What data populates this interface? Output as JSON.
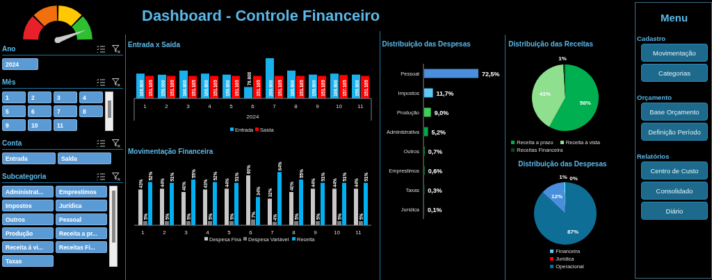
{
  "dashboard_title": "Dashboard - Controle Financeiro",
  "slicers": [
    {
      "title": "Ano",
      "kind": "compact",
      "items": [
        {
          "label": "2024",
          "selected": true
        }
      ]
    },
    {
      "title": "Mês",
      "kind": "grid",
      "items": [
        {
          "label": "1",
          "selected": true
        },
        {
          "label": "2",
          "selected": true
        },
        {
          "label": "3",
          "selected": true
        },
        {
          "label": "4",
          "selected": true
        },
        {
          "label": "5",
          "selected": true
        },
        {
          "label": "6",
          "selected": true
        },
        {
          "label": "7",
          "selected": true
        },
        {
          "label": "8",
          "selected": true
        },
        {
          "label": "9",
          "selected": true
        },
        {
          "label": "10",
          "selected": true
        },
        {
          "label": "11",
          "selected": true
        }
      ]
    },
    {
      "title": "Conta",
      "kind": "pair",
      "items": [
        {
          "label": "Entrada",
          "selected": true
        },
        {
          "label": "Saída",
          "selected": true
        }
      ]
    },
    {
      "title": "Subcategoria",
      "kind": "list",
      "items": [
        {
          "label": "Administrat...",
          "selected": true
        },
        {
          "label": "Emprestimos",
          "selected": true
        },
        {
          "label": "Impostos",
          "selected": true
        },
        {
          "label": "Jurídica",
          "selected": true
        },
        {
          "label": "Outros",
          "selected": true
        },
        {
          "label": "Pessoal",
          "selected": true
        },
        {
          "label": "Produção",
          "selected": true
        },
        {
          "label": "Receita a pr...",
          "selected": true
        },
        {
          "label": "Receita á vi...",
          "selected": true
        },
        {
          "label": "Receitas Fi...",
          "selected": true
        },
        {
          "label": "Taxas",
          "selected": true
        }
      ]
    }
  ],
  "entrada_saida": {
    "chart_data": {
      "type": "bar",
      "title": "Entrada x Saída",
      "xlabel": "2024",
      "legend": "bottom",
      "categories": [
        "1",
        "2",
        "3",
        "4",
        "5",
        "6",
        "7",
        "8",
        "9",
        "10",
        "11"
      ],
      "data_labels": true,
      "series": [
        {
          "name": "Entrada",
          "color": "#1ab0ec",
          "values": [
            166800,
            159000,
            186800,
            166800,
            159800,
            76800,
            269800,
            186800,
            159800,
            166800,
            159800
          ],
          "value_labels": [
            "166.800",
            "159.000",
            "186.800",
            "166.800",
            "159.800",
            "76.800",
            "269.800",
            "186.800",
            "159.800",
            "166.800",
            "159.800"
          ]
        },
        {
          "name": "Saída",
          "color": "#ff0000",
          "values": [
            151165,
            151165,
            151165,
            151165,
            151165,
            151165,
            151165,
            151165,
            151165,
            157165,
            151165
          ],
          "value_labels": [
            "151.165",
            "151.165",
            "151.165",
            "151.165",
            "151.165",
            "151.165",
            "151.165",
            "151.165",
            "151.165",
            "157.165",
            "151.165"
          ]
        }
      ]
    }
  },
  "movimentacao": {
    "chart_data": {
      "type": "bar",
      "title": "Movimentação Financeira",
      "legend": "bottom",
      "categories": [
        "1",
        "2",
        "3",
        "4",
        "5",
        "6",
        "7",
        "8",
        "9",
        "10",
        "11"
      ],
      "data_labels": true,
      "series": [
        {
          "name": "Despesa Fixa",
          "color": "#c8c8c8",
          "values": [
            43,
            44,
            40,
            43,
            44,
            60,
            32,
            40,
            44,
            44,
            44
          ],
          "value_labels": [
            "43%",
            "44%",
            "40%",
            "43%",
            "44%",
            "60%",
            "32%",
            "40%",
            "44%",
            "44%",
            "44%"
          ]
        },
        {
          "name": "Despesa Variável",
          "color": "#7f7f7f",
          "values": [
            5,
            5,
            5,
            5,
            5,
            7,
            4,
            5,
            5,
            5,
            5
          ],
          "value_labels": [
            "5%",
            "5%",
            "5%",
            "5%",
            "5%",
            "7%",
            "4%",
            "5%",
            "5%",
            "5%",
            "5%"
          ]
        },
        {
          "name": "Receita",
          "color": "#00b0f0",
          "values": [
            52,
            51,
            55,
            52,
            51,
            34,
            64,
            55,
            51,
            51,
            51
          ],
          "value_labels": [
            "52%",
            "51%",
            "55%",
            "52%",
            "51%",
            "34%",
            "64%",
            "55%",
            "51%",
            "51%",
            "51%"
          ]
        }
      ]
    }
  },
  "despesas_bar": {
    "chart_data": {
      "type": "bar",
      "orientation": "horizontal",
      "title": "Distribuição das Despesas",
      "categories": [
        "Pessoal",
        "Impostos",
        "Produção",
        "Administrativa",
        "Outros",
        "Emprestimos",
        "Taxas",
        "Jurídica"
      ],
      "data_labels": true,
      "series": [
        {
          "values": [
            72.5,
            11.7,
            9.0,
            5.2,
            0.7,
            0.6,
            0.3,
            0.1
          ],
          "value_labels": [
            "72,5%",
            "11,7%",
            "9,0%",
            "5,2%",
            "0,7%",
            "0,6%",
            "0,3%",
            "0,1%"
          ],
          "colors": [
            "#4a8fdb",
            "#5bc8f5",
            "#3ecf5a",
            "#00a846",
            "#00a846",
            "#00a846",
            "#00a846",
            "#00a846"
          ]
        }
      ]
    }
  },
  "receitas_pie": {
    "chart_data": {
      "type": "pie",
      "title": "Distribuição das Receitas",
      "legend": "bottom",
      "categories": [
        "Receita a prazo",
        "Receita á vista",
        "Receitas Financeira"
      ],
      "data_labels": true,
      "series": [
        {
          "values": [
            58,
            41,
            1
          ],
          "value_labels": [
            "58%",
            "41%",
            "1%"
          ],
          "colors": [
            "#00b050",
            "#8ee08e",
            "#0c4a1e"
          ]
        }
      ]
    }
  },
  "despesas_pie": {
    "chart_data": {
      "type": "pie",
      "title": "Distribuição das Despesas",
      "legend": "bottom",
      "categories": [
        "Financeira",
        "Jurídica",
        "Operacional",
        null
      ],
      "data_labels": true,
      "series": [
        {
          "values": [
            1,
            0,
            87,
            12
          ],
          "value_labels": [
            "1%",
            "0%",
            "87%",
            "12%"
          ],
          "colors": [
            "#5bc8f5",
            "#ff0000",
            "#0e6e96",
            "#4a8fdb"
          ]
        }
      ]
    }
  },
  "menu": {
    "title": "Menu",
    "sections": [
      {
        "title": "Cadastro",
        "buttons": [
          "Movimentação",
          "Categorias"
        ]
      },
      {
        "title": "Orçamento",
        "buttons": [
          "Base Orçamento",
          "Definição Período"
        ]
      },
      {
        "title": "Relatórios",
        "buttons": [
          "Centro de Custo",
          "Consolidado",
          "Diário"
        ]
      }
    ]
  }
}
